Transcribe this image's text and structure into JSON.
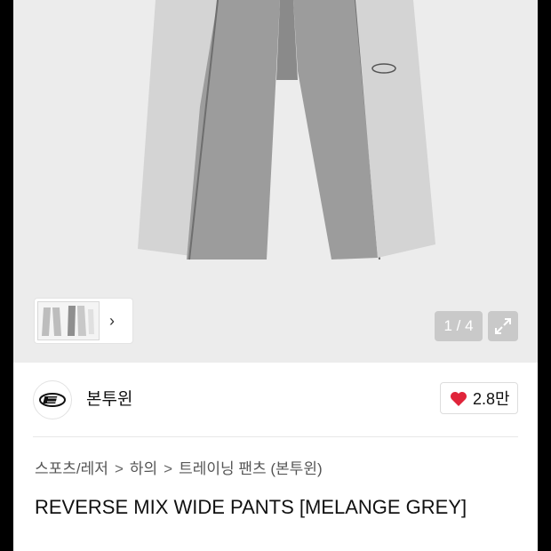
{
  "gallery": {
    "pager_text": "1 / 4",
    "expand_icon": "expand-arrows-icon",
    "next_icon": "chevron-right-icon"
  },
  "store": {
    "name": "본투윈",
    "logo_icon": "brand-logo-icon",
    "like_count": "2.8만",
    "heart_color": "#e0243a"
  },
  "breadcrumb": {
    "items": [
      "스포츠/레저",
      "하의",
      "트레이닝 팬츠 (본투윈)"
    ],
    "separator": ">"
  },
  "product": {
    "title": "REVERSE MIX WIDE PANTS [MELANGE GREY]"
  }
}
